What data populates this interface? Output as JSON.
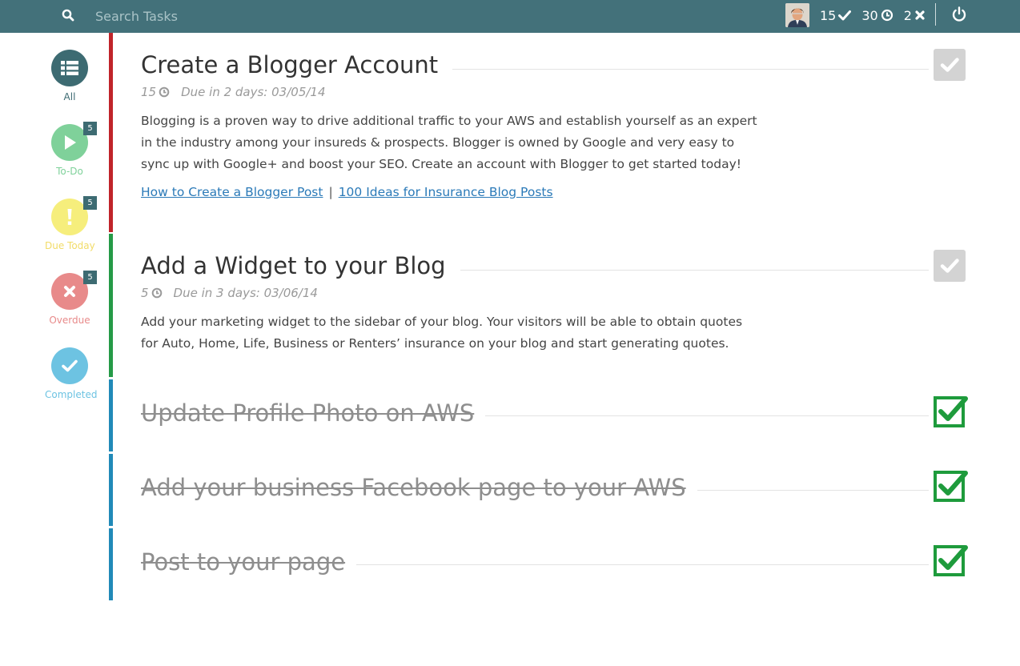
{
  "search": {
    "placeholder": "Search Tasks"
  },
  "header": {
    "stats": [
      {
        "value": "15",
        "icon": "check-icon"
      },
      {
        "value": "30",
        "icon": "clock-icon"
      },
      {
        "value": "2",
        "icon": "x-icon"
      }
    ]
  },
  "filters": [
    {
      "label": "All",
      "color": "#3d6b72",
      "label_color": "#3d6b72",
      "icon": "list-icon"
    },
    {
      "label": "To-Do",
      "color": "#7fd19a",
      "label_color": "#7fd19a",
      "icon": "play-icon",
      "badge": "5"
    },
    {
      "label": "Due Today",
      "color": "#f6ee7c",
      "label_color": "#f2dc68",
      "icon": "exclamation-icon",
      "badge": "5"
    },
    {
      "label": "Overdue",
      "color": "#e88a8a",
      "label_color": "#e88a8a",
      "icon": "x-icon",
      "badge": "5"
    },
    {
      "label": "Completed",
      "color": "#6dc3e2",
      "label_color": "#6dc3e2",
      "icon": "check-icon"
    }
  ],
  "rail_colors": {
    "overdue": "#c0242a",
    "due_today": "#259a47",
    "completed": "#218ab8"
  },
  "tasks": [
    {
      "title": "Create a Blogger Account",
      "points": "15",
      "due": "Due in 2 days: 03/05/14",
      "description": "Blogging is a proven way to drive additional traffic to your AWS and establish yourself as an expert in the industry among your insureds & prospects. Blogger is owned by Google and very easy to sync up with Google+ and boost your SEO. Create an account with Blogger to get started today!",
      "links": [
        "How to Create a Blogger Post",
        "100 Ideas for Insurance Blog Posts"
      ],
      "link_separator": "|"
    },
    {
      "title": "Add a Widget to your Blog",
      "points": "5",
      "due": "Due in 3 days: 03/06/14",
      "description": "Add your marketing widget to the sidebar of your blog. Your visitors will be able to obtain quotes for Auto, Home, Life, Business or Renters’ insurance on your blog and start generating quotes."
    }
  ],
  "completed_tasks": [
    {
      "title": "Update Profile Photo on AWS"
    },
    {
      "title": "Add your business Facebook page to your AWS"
    },
    {
      "title": "Post to your page"
    }
  ]
}
